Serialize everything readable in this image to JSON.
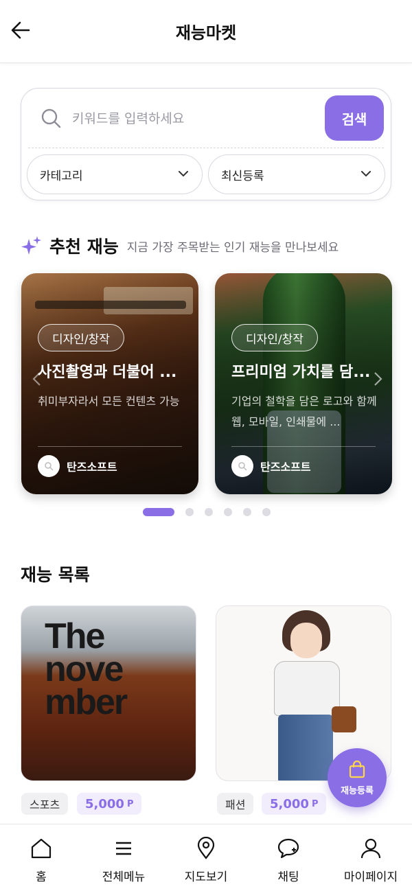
{
  "header": {
    "title": "재능마켓",
    "back_icon": "arrow-left-icon"
  },
  "search": {
    "placeholder": "키워드를 입력하세요",
    "value": "",
    "button_label": "검색",
    "category_dropdown": "카테고리",
    "sort_dropdown": "최신등록"
  },
  "recommend": {
    "title": "추천 재능",
    "subtitle": "지금 가장 주목받는 인기 재능을 만나보세요",
    "cards": [
      {
        "category": "디자인/창작",
        "title": "사진촬영과 더불어 ...",
        "desc": "취미부자라서 모든 컨텐츠 가능",
        "author": "탄즈소프트"
      },
      {
        "category": "디자인/창작",
        "title": "프리미엄 가치를 담...",
        "desc": "기업의 철학을 담은 로고와 함께 웹, 모바일, 인쇄물에 ...",
        "author": "탄즈소프트"
      }
    ],
    "pagination": {
      "total": 6,
      "active": 1
    }
  },
  "list": {
    "title": "재능 목록",
    "items": [
      {
        "image_text": "The november",
        "category": "스포츠",
        "price": "5,000",
        "unit": "P"
      },
      {
        "category": "패션",
        "price": "5,000",
        "unit": "P"
      }
    ]
  },
  "fab": {
    "label": "재능등록",
    "icon": "shopping-bag-icon"
  },
  "bottom_nav": [
    {
      "label": "홈",
      "icon": "home-icon"
    },
    {
      "label": "전체메뉴",
      "icon": "menu-icon"
    },
    {
      "label": "지도보기",
      "icon": "map-pin-icon"
    },
    {
      "label": "채팅",
      "icon": "chat-icon"
    },
    {
      "label": "마이페이지",
      "icon": "user-icon"
    }
  ],
  "colors": {
    "accent": "#8a6ee6",
    "accent_light": "#f1edfd"
  }
}
